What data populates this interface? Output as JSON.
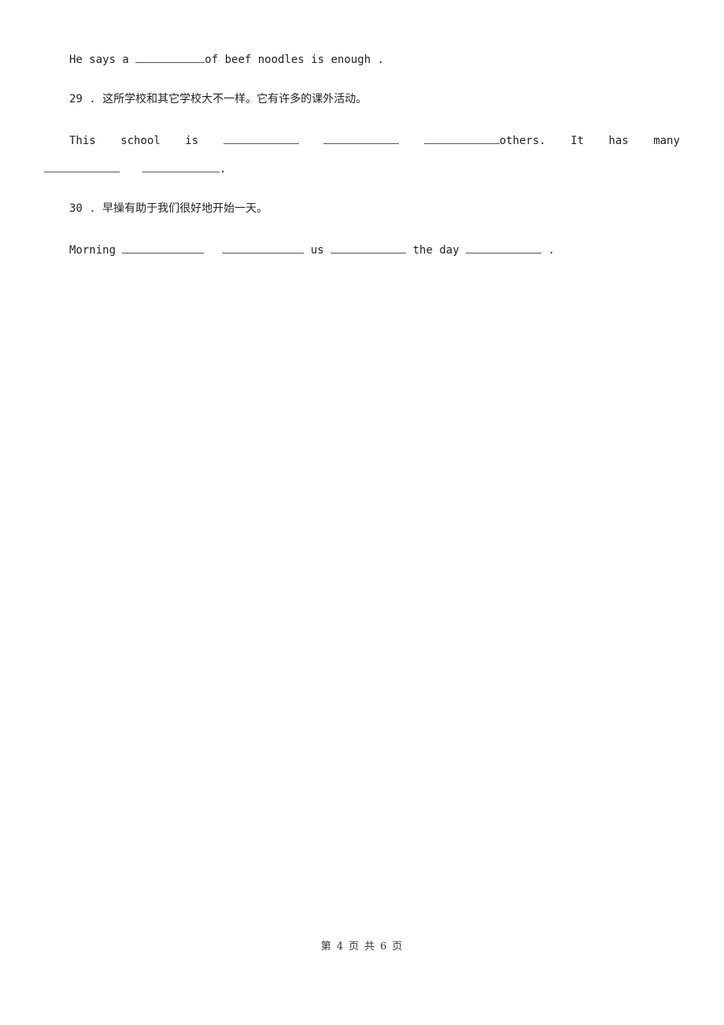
{
  "q28_tail": {
    "before": "He says a",
    "after": "of beef noodles is enough ."
  },
  "q29": {
    "number": "29",
    "dot": ".",
    "prompt": "这所学校和其它学校大不一样。它有许多的课外活动。",
    "words": [
      "This",
      "school",
      "is"
    ],
    "after_blanks": "others.",
    "words2": [
      "It",
      "has",
      "many"
    ],
    "end": "."
  },
  "q30": {
    "number": "30",
    "dot": ".",
    "prompt": "早操有助于我们很好地开始一天。",
    "word1": "Morning",
    "word2": "us",
    "word3": "the day",
    "end": "."
  },
  "footer": {
    "prefix": "第",
    "current": "4",
    "mid1": "页",
    "mid2": "共",
    "total": "6",
    "suffix": "页"
  }
}
